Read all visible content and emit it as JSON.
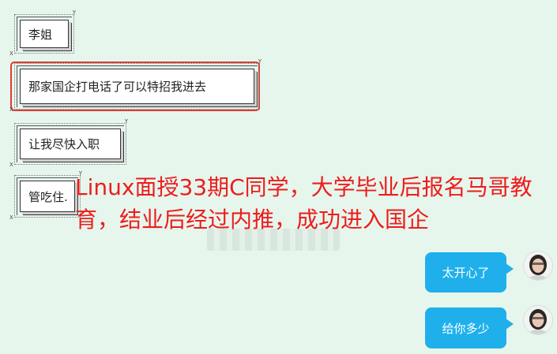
{
  "chat": {
    "left_messages": [
      {
        "text": "李姐"
      },
      {
        "text": "那家国企打电话了可以特招我进去"
      },
      {
        "text": "让我尽快入职"
      },
      {
        "text": "管吃住."
      }
    ],
    "right_messages": [
      {
        "text": "太开心了"
      },
      {
        "text": "给你多少"
      }
    ]
  },
  "overlay": {
    "caption": "Linux面授33期C同学，大学毕业后报名马哥教育，结业后经过内推，成功进入国企"
  },
  "colors": {
    "background": "#e6f6ed",
    "highlight_border": "#e23b30",
    "overlay_text": "#ee1c1c",
    "right_bubble": "#1fb0ec"
  }
}
